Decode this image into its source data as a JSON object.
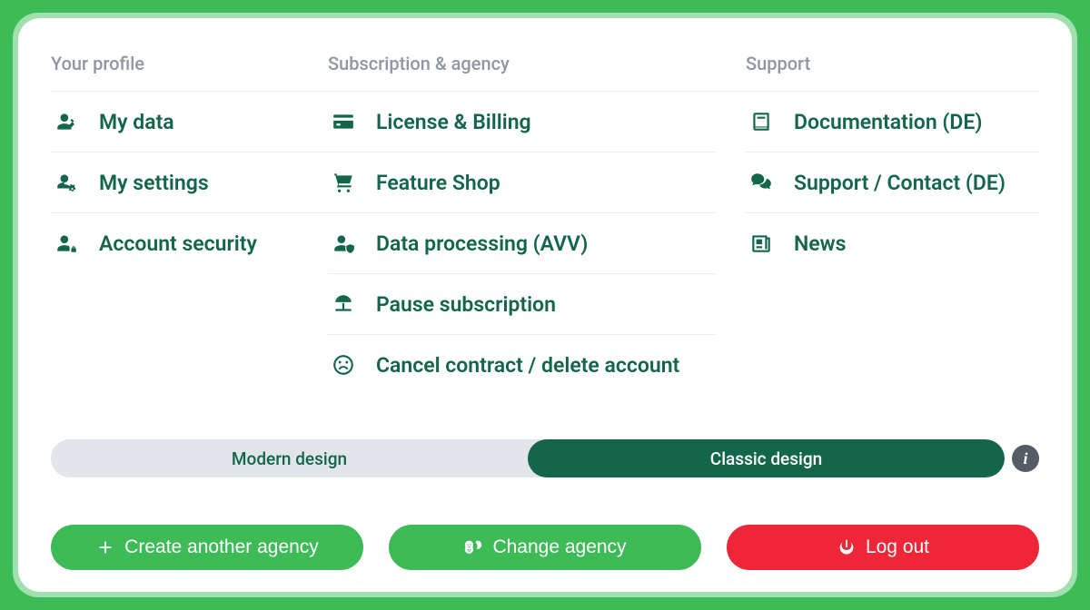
{
  "columns": {
    "profile": {
      "heading": "Your profile",
      "items": [
        {
          "label": "My data"
        },
        {
          "label": "My settings"
        },
        {
          "label": "Account security"
        }
      ]
    },
    "subscription": {
      "heading": "Subscription & agency",
      "items": [
        {
          "label": "License & Billing"
        },
        {
          "label": "Feature Shop"
        },
        {
          "label": "Data processing (AVV)"
        },
        {
          "label": "Pause subscription"
        },
        {
          "label": "Cancel contract / delete account"
        }
      ]
    },
    "support": {
      "heading": "Support",
      "items": [
        {
          "label": "Documentation (DE)"
        },
        {
          "label": "Support / Contact (DE)"
        },
        {
          "label": "News"
        }
      ]
    }
  },
  "toggle": {
    "option_inactive": "Modern design",
    "option_active": "Classic design"
  },
  "buttons": {
    "create_agency": "Create another agency",
    "change_agency": "Change agency",
    "logout": "Log out"
  }
}
